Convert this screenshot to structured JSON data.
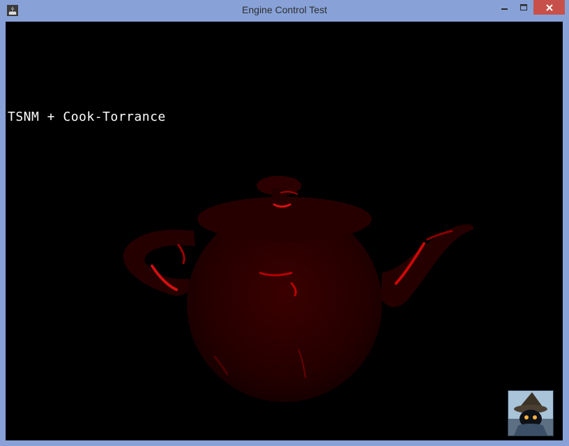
{
  "window": {
    "title": "Engine Control Test",
    "frame_color": "#88a2d8",
    "close_color": "#c7504a"
  },
  "icons": {
    "app": "app-icon",
    "minimize": "minimize-icon",
    "maximize": "maximize-icon",
    "close": "close-icon"
  },
  "viewport": {
    "overlay_text": "TSNM + Cook-Torrance",
    "background": "#000000",
    "object": "teapot-render",
    "avatar": "wizard-avatar"
  }
}
